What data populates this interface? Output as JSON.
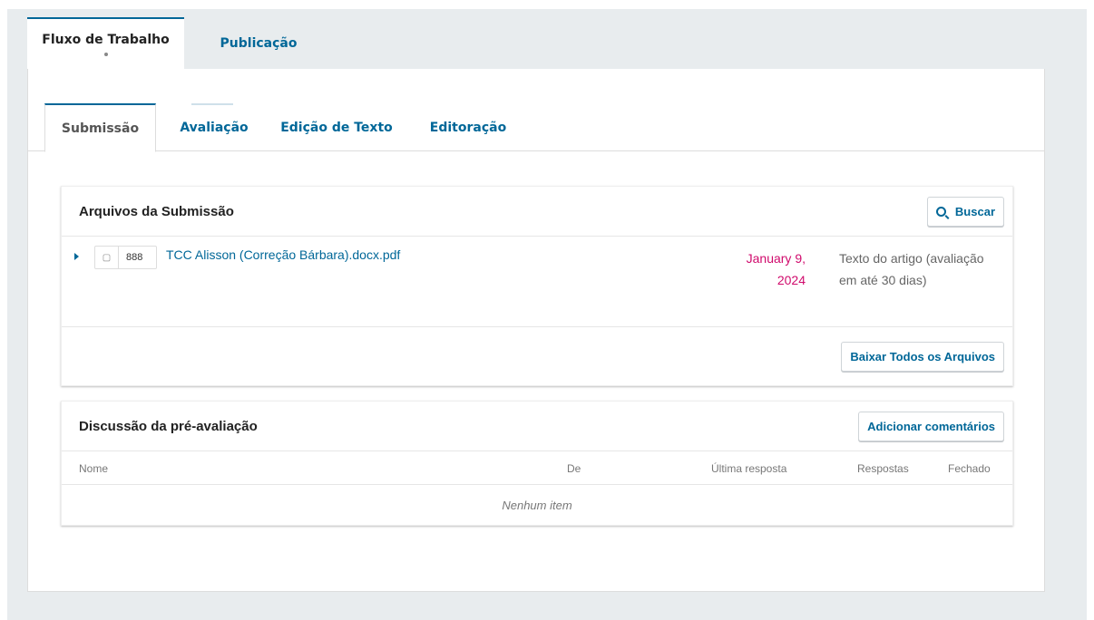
{
  "outer_tabs": [
    {
      "label": "Fluxo de Trabalho",
      "active": true
    },
    {
      "label": "Publicação",
      "active": false
    }
  ],
  "inner_tabs": [
    {
      "label": "Submissão",
      "active": true
    },
    {
      "label": "Avaliação",
      "active": false
    },
    {
      "label": "Edição de Texto",
      "active": false
    },
    {
      "label": "Editoração",
      "active": false
    }
  ],
  "files_panel": {
    "title": "Arquivos da Submissão",
    "search_label": "Buscar",
    "files": [
      {
        "id": "888",
        "name": "TCC Alisson (Correção Bárbara).docx.pdf",
        "date": "January 9, 2024",
        "type": "Texto do artigo (avaliação em até 30 dias)"
      }
    ],
    "download_all_label": "Baixar Todos os Arquivos"
  },
  "discussion_panel": {
    "title": "Discussão da pré-avaliação",
    "add_label": "Adicionar comentários",
    "columns": [
      "Nome",
      "De",
      "Última resposta",
      "Respostas",
      "Fechado"
    ],
    "empty_text": "Nenhum item"
  },
  "colors": {
    "accent": "#006798",
    "date": "#d00a6c",
    "background": "#e8ecee"
  }
}
